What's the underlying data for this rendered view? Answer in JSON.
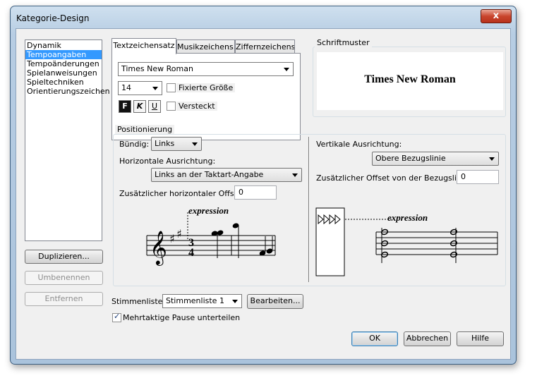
{
  "window": {
    "title": "Kategorie-Design",
    "close_glyph": "x"
  },
  "categories": {
    "items": [
      "Dynamik",
      "Tempoangaben",
      "Tempoänderungen",
      "Spielanweisungen",
      "Spieltechniken",
      "Orientierungszeichen"
    ],
    "selected_index": 1
  },
  "buttons": {
    "duplicate": "Duplizieren...",
    "rename": "Umbenennen",
    "remove": "Entfernen",
    "edit": "Bearbeiten...",
    "ok": "OK",
    "cancel": "Abbrechen",
    "help": "Hilfe"
  },
  "tabs": [
    {
      "label": "Textzeichensatz",
      "active": true
    },
    {
      "label": "Musikzeichens.",
      "active": false
    },
    {
      "label": "Ziffernzeichens.",
      "active": false
    }
  ],
  "font": {
    "name": "Times New Roman",
    "size": "14",
    "fixed_size_label": "Fixierte Größe",
    "fixed_size_checked": false,
    "hidden_label": "Versteckt",
    "hidden_checked": false,
    "style_buttons": [
      {
        "label": "F",
        "name": "bold",
        "pressed": true
      },
      {
        "label": "K",
        "name": "italic",
        "pressed": false
      },
      {
        "label": "U",
        "name": "underline",
        "pressed": false
      }
    ]
  },
  "preview": {
    "group_label": "Schriftmuster",
    "sample_text": "Times New Roman"
  },
  "positioning": {
    "group_label": "Positionierung",
    "justify_label": "Bündig:",
    "justify_value": "Links",
    "halign_label": "Horizontale Ausrichtung:",
    "halign_value": "Links an der Taktart-Angabe",
    "hoffset_label": "Zusätzlicher horizontaler Offset:",
    "hoffset_value": "0",
    "valign_label": "Vertikale Ausrichtung:",
    "valign_value": "Obere Bezugslinie",
    "voffset_label": "Zusätzlicher Offset von der Bezugslinie:",
    "voffset_value": "0",
    "example_left_text": "expression",
    "example_right_text": "expression",
    "time_signature": [
      "3",
      "4"
    ]
  },
  "staff_list": {
    "label": "Stimmenliste:",
    "value": "Stimmenliste 1",
    "split_rests_label": "Mehrtaktige Pause unterteilen",
    "split_rests_checked": true
  },
  "colors": {
    "selection": "#3399ff",
    "close_button": "#c9452d"
  }
}
